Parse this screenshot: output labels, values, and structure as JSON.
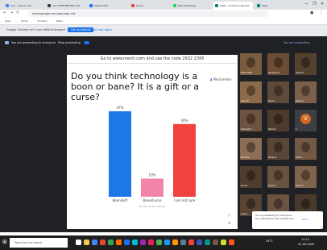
{
  "browser": {
    "tabs": [
      {
        "label": "Live - search.com",
        "color": "#4285f4"
      },
      {
        "label": "Your MENTIMETER Vote",
        "color": "#3c3c3c"
      },
      {
        "label": "Mentimeter",
        "color": "#1a73e8"
      },
      {
        "label": "Gmail",
        "color": "#ea4335"
      },
      {
        "label": "Web Whatsapp",
        "color": "#25d366"
      },
      {
        "label": "Meet - Quarterly Review",
        "color": "#00897b"
      },
      {
        "label": "Meet",
        "color": "#00897b"
      }
    ],
    "url": "meet.google.com/xgs-twjk-nnt",
    "bookmarks": [
      "Apps",
      "Gmail",
      "YouTube",
      "Maps"
    ],
    "window_controls": [
      "—",
      "❐",
      "✕"
    ]
  },
  "infobar": {
    "text": "Google Chrome isn't your default browser",
    "primary": "Set as default",
    "secondary": "Don't ask again"
  },
  "meetbar": {
    "presenting_text": "You are presenting to everyone",
    "stop_label": "Stop presenting",
    "right_label": "You are presenting"
  },
  "slide": {
    "header": "Go to www.menti.com and use the code 2932 2395",
    "question": "Do you think technology is a boon or bane? It is a gift or a curse?",
    "brand": "Mentimeter",
    "footer": "Results hidden settings"
  },
  "chart_data": {
    "type": "bar",
    "categories": [
      "Boon/Gift",
      "Bane/Curse",
      "I am not sure"
    ],
    "values": [
      47,
      10,
      40
    ],
    "labels": [
      "47%",
      "10%",
      "40%"
    ],
    "colors": [
      "#1e77e8",
      "#f284a9",
      "#f2423f"
    ]
  },
  "participants": [
    {
      "name": "Kedar Nath",
      "color": "#7a5c3e"
    },
    {
      "name": "Sharanya S",
      "color": "#6b4d36"
    },
    {
      "name": "Vedant J",
      "color": "#53402f"
    },
    {
      "name": "Arjun M",
      "color": "#8a6a4a"
    },
    {
      "name": "Diya P",
      "color": "#5e4a3a"
    },
    {
      "name": "Aarav G",
      "color": "#7d604a"
    },
    {
      "name": "Dhanush A",
      "color": "#6e5440"
    },
    {
      "name": "Nisha R",
      "color": "#4d3b2d"
    },
    {
      "name": "V",
      "color": "#d2691e",
      "initial": "V"
    },
    {
      "name": "Sai Kiran",
      "color": "#8b6e55"
    },
    {
      "name": "Rohan K",
      "color": "#5a4636"
    },
    {
      "name": "Aditi V",
      "color": "#745a45"
    },
    {
      "name": "Pranav",
      "color": "#4f3c2e"
    },
    {
      "name": "Meera S",
      "color": "#6a5240"
    },
    {
      "name": "Kavya T",
      "color": "#80634c"
    },
    {
      "name": "Ishaan",
      "color": "#574433"
    },
    {
      "name": "Varun",
      "color": "#6d5442"
    },
    {
      "name": "Tara",
      "color": "#4a3a2c"
    }
  ],
  "notification": {
    "text": "You're presenting to everyone. Any participant can present too.",
    "action": "Got it"
  },
  "taskbar": {
    "search_placeholder": "Type here to search",
    "time": "11:11",
    "date": "01-09-2020",
    "weather": "25°C"
  }
}
